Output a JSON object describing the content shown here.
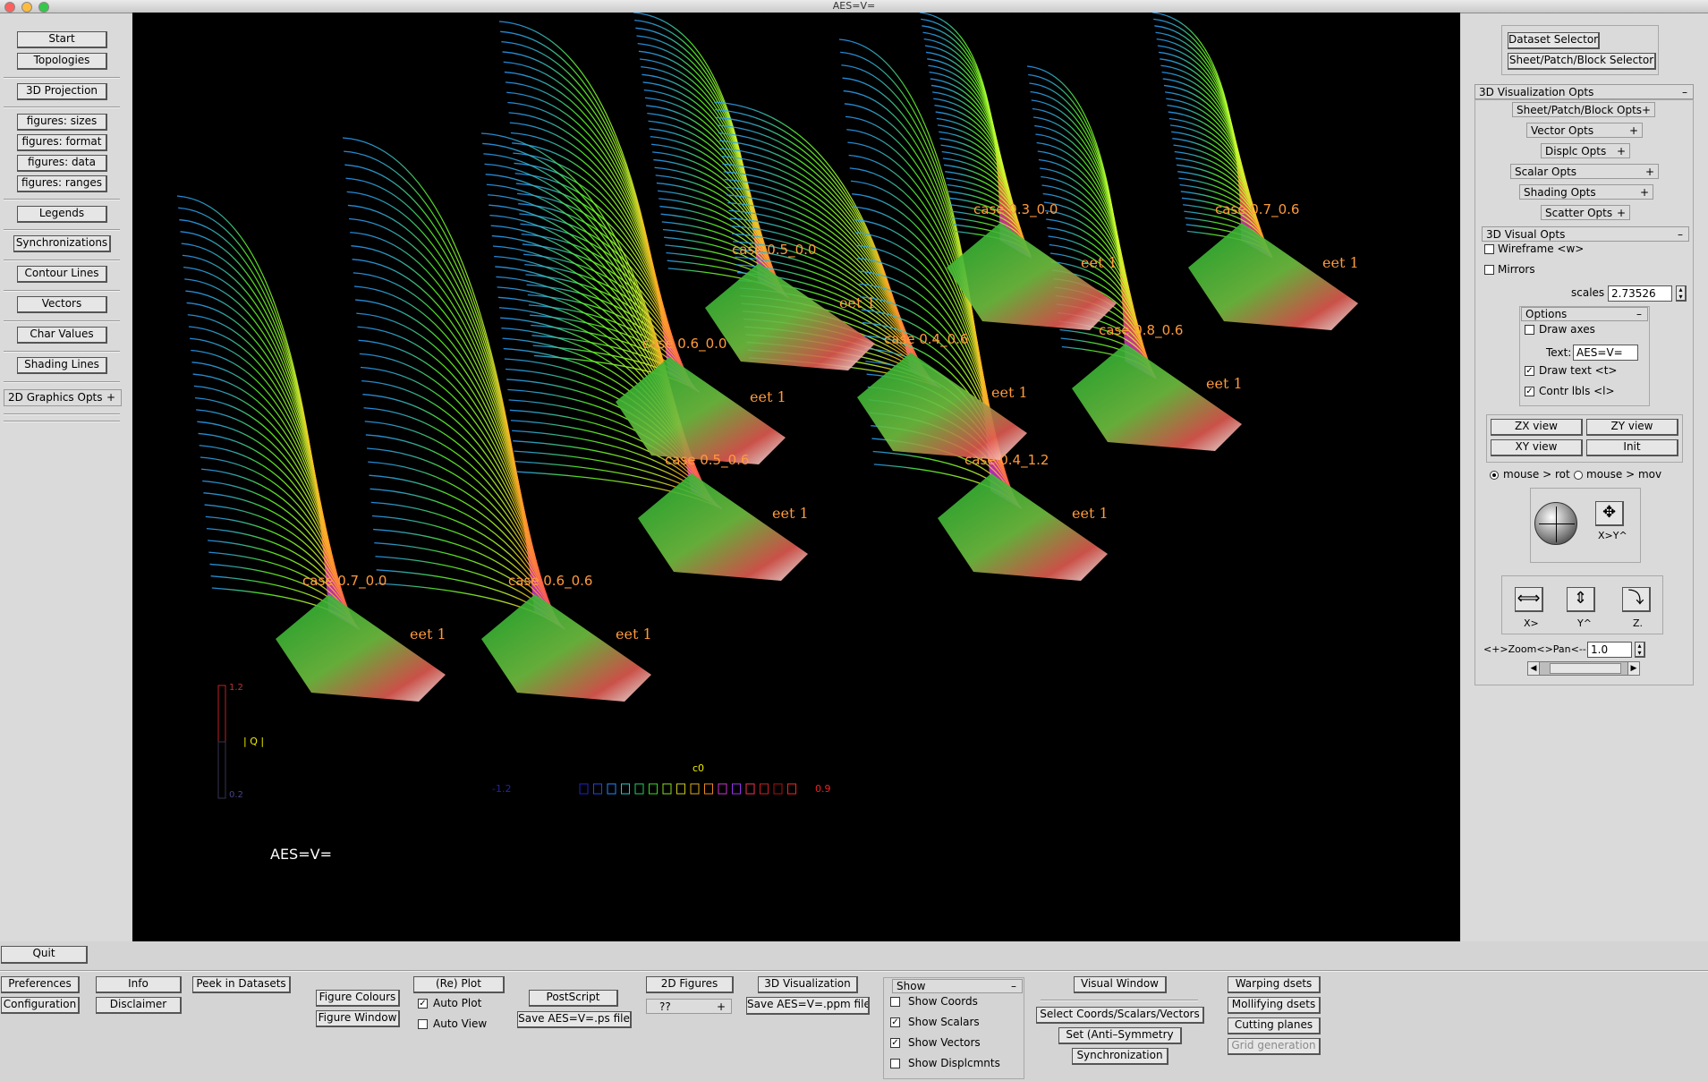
{
  "window": {
    "title": "AES=V="
  },
  "left_panel": {
    "buttons": [
      "Start",
      "Topologies",
      "3D Projection",
      "figures: sizes",
      "figures: format",
      "figures: data",
      "figures: ranges",
      "Legends",
      "Synchronizations",
      "Contour Lines",
      "Vectors",
      "Char Values",
      "Shading Lines"
    ],
    "graphics_opts": "2D Graphics Opts",
    "plus": "+"
  },
  "canvas": {
    "cases": [
      "case 0.7_0.0",
      "case 0.6_0.6",
      "case 0.6_0.0",
      "case 0.5_0.6",
      "case 0.5_0.0",
      "case 0.4_0.6",
      "case 0.4_1.2",
      "case 0.3_0.0",
      "case 0.8_0.6",
      "case 0.7_0.6"
    ],
    "sheet_label": "eet 1",
    "legend_q": {
      "max": "1.2",
      "min": "0.2",
      "label": "| Q |"
    },
    "legend_c0": {
      "min": "-1.2",
      "max": "0.9",
      "label": "c0"
    },
    "caption": "AES=V="
  },
  "right_panel": {
    "dataset_selector": "Dataset Selector",
    "block_selector": "Sheet/Patch/Block Selector",
    "viz_opts": "3D Visualization Opts",
    "minus": "–",
    "plus": "+",
    "sub_opts": [
      "Sheet/Patch/Block Opts",
      "Vector  Opts",
      "Displc  Opts",
      "Scalar  Opts",
      "Shading  Opts",
      "Scatter Opts"
    ],
    "visual_opts": "3D Visual Opts",
    "wireframe": "Wireframe <w>",
    "mirrors": "Mirrors",
    "scales_label": "scales",
    "scales_value": "2.73526",
    "options_header": "Options",
    "draw_axes": "Draw axes",
    "text_label": "Text:",
    "text_value": "AES=V=",
    "draw_text": "Draw   text <t>",
    "contr_lbls": "Contr lbls <l>",
    "views": [
      "ZX view",
      "ZY view",
      "XY view",
      "Init"
    ],
    "mouse_rot": "mouse >  rot",
    "mouse_mov": "mouse >  mov",
    "xy_label": "X>Y^",
    "axis_labels": [
      "X>",
      "Y^",
      "Z."
    ],
    "zoom_label": "<+>Zoom<>Pan<-->",
    "zoom_value": "1.0"
  },
  "bottom": {
    "quit": "Quit",
    "preferences": "Preferences",
    "configuration": "Configuration",
    "info": "Info",
    "disclaimer": "Disclaimer",
    "peek": "Peek in Datasets",
    "figure_colours": "Figure Colours",
    "figure_window": "Figure Window",
    "replot": "(Re) Plot",
    "auto_plot": "Auto Plot",
    "auto_view": "Auto View",
    "postscript": "PostScript",
    "save_ps": "Save AES=V=.ps file",
    "figures_2d": "2D Figures",
    "select_value": "??",
    "viz_3d": "3D Visualization",
    "save_ppm": "Save AES=V=.ppm file",
    "show": "Show",
    "show_coords": "Show Coords",
    "show_scalars": "Show Scalars",
    "show_vectors": "Show Vectors",
    "show_displ": "Show Displcmnts",
    "visual_window": "Visual Window",
    "select_coords": "Select Coords/Scalars/Vectors",
    "set_anti": "Set    (Anti–Symmetry",
    "synchronization": "Synchronization",
    "warping": "Warping    dsets",
    "mollifying": "Mollifying dsets",
    "cutting": "Cutting planes",
    "grid_gen": "Grid generation"
  }
}
